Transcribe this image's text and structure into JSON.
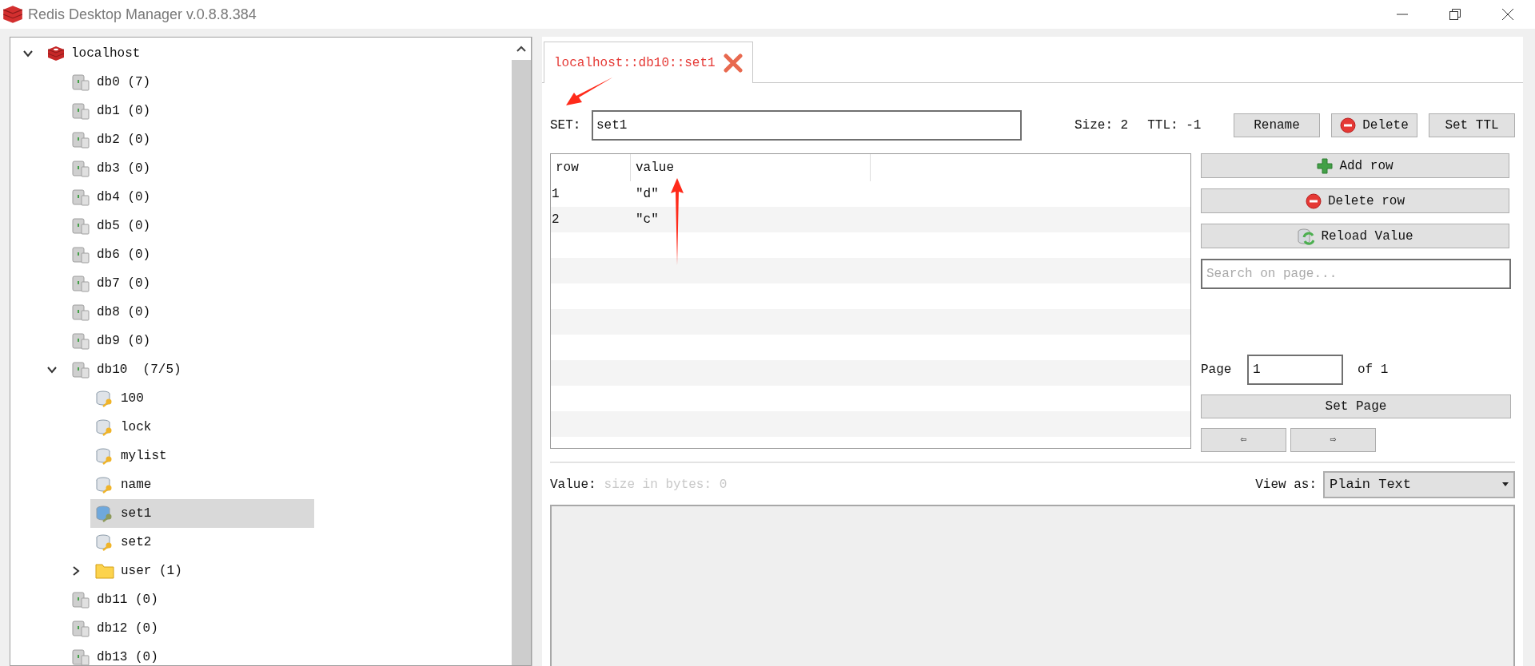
{
  "window": {
    "title": "Redis Desktop Manager v.0.8.8.384"
  },
  "tree": [
    {
      "kind": "server",
      "label": "localhost",
      "expanded": true,
      "selected": false,
      "children": [
        {
          "kind": "db",
          "label": "db0 (7)",
          "selected": false
        },
        {
          "kind": "db",
          "label": "db1 (0)",
          "selected": false
        },
        {
          "kind": "db",
          "label": "db2 (0)",
          "selected": false
        },
        {
          "kind": "db",
          "label": "db3 (0)",
          "selected": false
        },
        {
          "kind": "db",
          "label": "db4 (0)",
          "selected": false
        },
        {
          "kind": "db",
          "label": "db5 (0)",
          "selected": false
        },
        {
          "kind": "db",
          "label": "db6 (0)",
          "selected": false
        },
        {
          "kind": "db",
          "label": "db7 (0)",
          "selected": false
        },
        {
          "kind": "db",
          "label": "db8 (0)",
          "selected": false
        },
        {
          "kind": "db",
          "label": "db9 (0)",
          "selected": false
        },
        {
          "kind": "db",
          "label": "db10  (7/5)",
          "expanded": true,
          "selected": false,
          "children": [
            {
              "kind": "key",
              "label": "100",
              "selected": false
            },
            {
              "kind": "key",
              "label": "lock",
              "selected": false
            },
            {
              "kind": "key",
              "label": "mylist",
              "selected": false
            },
            {
              "kind": "key",
              "label": "name",
              "selected": false
            },
            {
              "kind": "key",
              "label": "set1",
              "selected": true
            },
            {
              "kind": "key",
              "label": "set2",
              "selected": false
            },
            {
              "kind": "folder",
              "label": "user (1)",
              "expanded": false,
              "selected": false
            }
          ]
        },
        {
          "kind": "db",
          "label": "db11 (0)",
          "selected": false
        },
        {
          "kind": "db",
          "label": "db12 (0)",
          "selected": false
        },
        {
          "kind": "db",
          "label": "db13 (0)",
          "selected": false
        }
      ]
    }
  ],
  "tabs": [
    {
      "label": "localhost::db10::set1",
      "selected": true
    }
  ],
  "key": {
    "type_label": "SET:",
    "name": "set1",
    "size": "Size: 2",
    "ttl": "TTL: -1",
    "buttons": [
      {
        "kind": "plain",
        "label": "Rename"
      },
      {
        "kind": "delete",
        "label": "Delete"
      },
      {
        "kind": "plain",
        "label": "Set TTL"
      }
    ]
  },
  "table": {
    "columns": [
      "row",
      "value"
    ],
    "rows": [
      [
        "1",
        "\"d\""
      ],
      [
        "2",
        "\"c\""
      ]
    ]
  },
  "side": {
    "buttons": [
      {
        "kind": "add",
        "label": "Add row"
      },
      {
        "kind": "delete",
        "label": "Delete row"
      },
      {
        "kind": "reload",
        "label": "Reload Value"
      }
    ],
    "search": {
      "placeholder": "Search on page..."
    },
    "page_label": "Page",
    "page_value": "1",
    "page_of": "of 1",
    "set_page": "Set Page",
    "prev": "⇦",
    "next": "⇨"
  },
  "value": {
    "label": "Value:",
    "size": "size in bytes: 0",
    "view_as": "View as:",
    "format": "Plain Text"
  }
}
